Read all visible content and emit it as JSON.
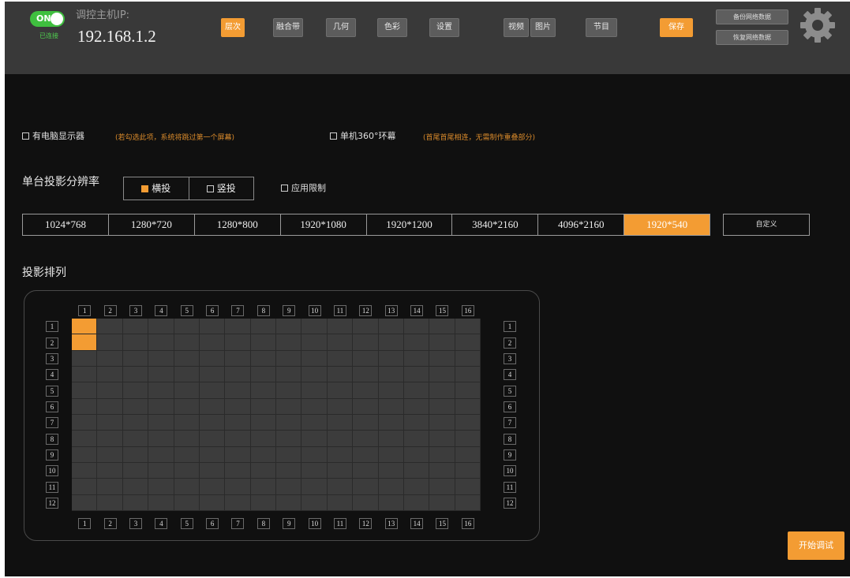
{
  "header": {
    "power_toggle": "ON",
    "online_status": "已连接",
    "host_label": "调控主机IP:",
    "host_ip": "192.168.1.2",
    "tabs": [
      {
        "label": "层次",
        "active": true
      },
      {
        "label": "融合带",
        "active": false
      },
      {
        "label": "几何",
        "active": false
      },
      {
        "label": "色彩",
        "active": false
      },
      {
        "label": "设置",
        "active": false
      }
    ],
    "media_tabs": [
      "视频",
      "图片"
    ],
    "program_label": "节目",
    "save_label": "保存",
    "backup_label": "备份网络数据",
    "restore_label": "恢复网络数据",
    "settings_icon": "gear-icon"
  },
  "options": {
    "tv_display_label": "有电脑显示器",
    "tv_display_note": "(若勾选此项，系统将跳过第一个屏幕)",
    "ring_label": "单机360°环幕",
    "ring_note": "(首尾首尾相连，无需制作重叠部分)"
  },
  "resolution": {
    "title": "单台投影分辨率",
    "orientation": [
      {
        "label": "横投",
        "checked": true
      },
      {
        "label": "竖投",
        "checked": false
      }
    ],
    "apply_limit_label": "应用限制",
    "options": [
      "1024*768",
      "1280*720",
      "1280*800",
      "1920*1080",
      "1920*1200",
      "3840*2160",
      "4096*2160",
      "1920*540"
    ],
    "selected": "1920*540",
    "custom_label": "自定义"
  },
  "arrangement": {
    "title": "投影排列",
    "columns": [
      "1",
      "2",
      "3",
      "4",
      "5",
      "6",
      "7",
      "8",
      "9",
      "10",
      "11",
      "12",
      "13",
      "14",
      "15",
      "16"
    ],
    "rows": [
      "1",
      "2",
      "3",
      "4",
      "5",
      "6",
      "7",
      "8",
      "9",
      "10",
      "11",
      "12"
    ],
    "selected_cells": [
      [
        1,
        1
      ],
      [
        2,
        1
      ]
    ]
  },
  "start_debug_label": "开始调试",
  "colors": {
    "accent": "#f39c33",
    "toggle_on": "#3fbf3f",
    "topbar": "#393939",
    "background": "#101010"
  }
}
